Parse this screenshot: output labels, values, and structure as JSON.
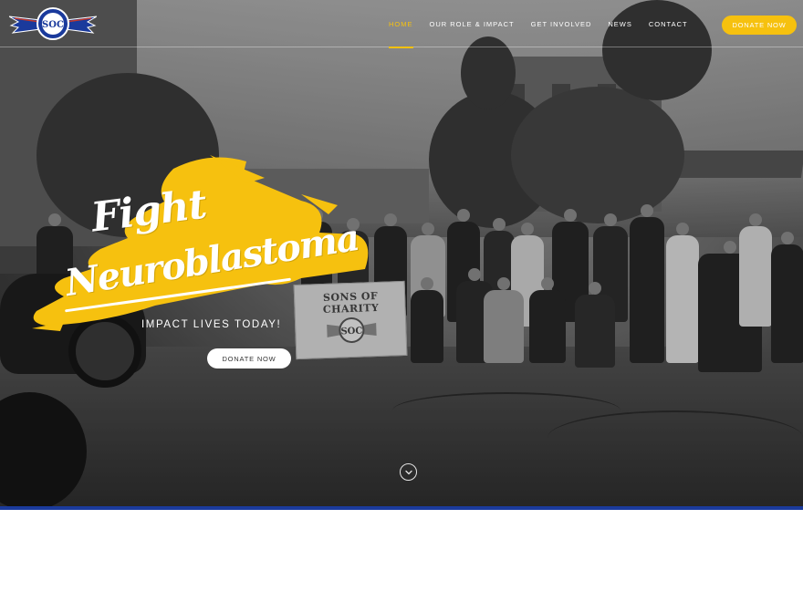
{
  "header": {
    "logo_icon": "soc-winged-shield-logo",
    "logo_text": "SOC",
    "nav": [
      {
        "label": "HOME",
        "active": true
      },
      {
        "label": "OUR ROLE & IMPACT",
        "active": false
      },
      {
        "label": "GET INVOLVED",
        "active": false
      },
      {
        "label": "NEWS",
        "active": false
      },
      {
        "label": "CONTACT",
        "active": false
      }
    ],
    "donate_label": "DONATE NOW"
  },
  "hero": {
    "headline_line1": "Fight",
    "headline_line2": "Neuroblastoma",
    "subheadline": "IMPACT LIVES TODAY!",
    "donate_label": "DONATE NOW",
    "banner_text": "SONS OF CHARITY",
    "banner_logo_text": "SOC",
    "scroll_icon": "chevron-down-icon"
  },
  "colors": {
    "accent": "#f6c10f",
    "brand_blue": "#1a3a9c",
    "nav_text": "#ffffff"
  }
}
